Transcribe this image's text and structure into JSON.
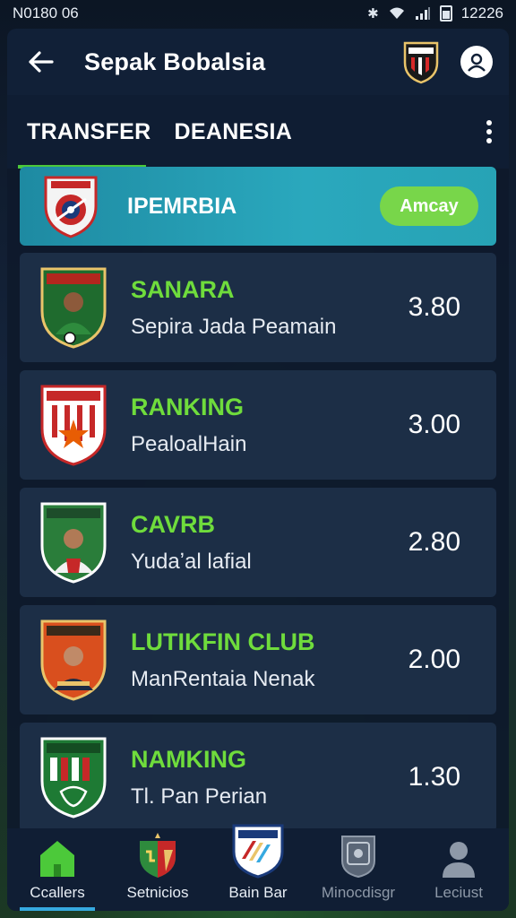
{
  "status_bar": {
    "time": "N0180 06",
    "clock": "12226",
    "icons": [
      "bluetooth-icon",
      "wifi-icon",
      "signal-icon",
      "battery-icon"
    ]
  },
  "app_bar": {
    "title": "Sepak Bobalsia",
    "back_icon": "arrow-left-icon",
    "profile_icon": "user-icon"
  },
  "tabs": [
    {
      "label": "TRANSFER",
      "active": true
    },
    {
      "label": "DEANESIA",
      "active": false
    }
  ],
  "banner": {
    "title": "IPEMRBIA",
    "button_label": "Amcay"
  },
  "rows": [
    {
      "name": "SANARA",
      "subtitle": "Sepira Jada Peamain",
      "value": "3.80",
      "crest": "crest-green-player"
    },
    {
      "name": "RANKING",
      "subtitle": "PealoalHain",
      "value": "3.00",
      "crest": "crest-red-star"
    },
    {
      "name": "CAVRB",
      "subtitle": "Yudaʼal lafial",
      "value": "2.80",
      "crest": "crest-green-player-2"
    },
    {
      "name": "LUTIKFIN CLUB",
      "subtitle": "ManRentaia Nenak",
      "value": "2.00",
      "crest": "crest-orange-player"
    },
    {
      "name": "NAMKING",
      "subtitle": "Tl. Pan Perian",
      "value": "1.30",
      "crest": "crest-green-stripes"
    }
  ],
  "bottom_nav": [
    {
      "label": "Ccallers",
      "icon": "home-icon",
      "active": true
    },
    {
      "label": "Setnicios",
      "icon": "club-crest-icon",
      "active": false
    },
    {
      "label": "Bain Bar",
      "icon": "shield-icon",
      "active": false
    },
    {
      "label": "Minocdisgr",
      "icon": "badge-icon",
      "active": false
    },
    {
      "label": "Leciust",
      "icon": "user-icon",
      "active": false
    }
  ],
  "colors": {
    "accent_green": "#6fdc3c",
    "banner_teal": "#2aa8bd",
    "button_green": "#78d64a",
    "card_bg": "#1c2e46",
    "nav_active": "#36a9e0"
  }
}
